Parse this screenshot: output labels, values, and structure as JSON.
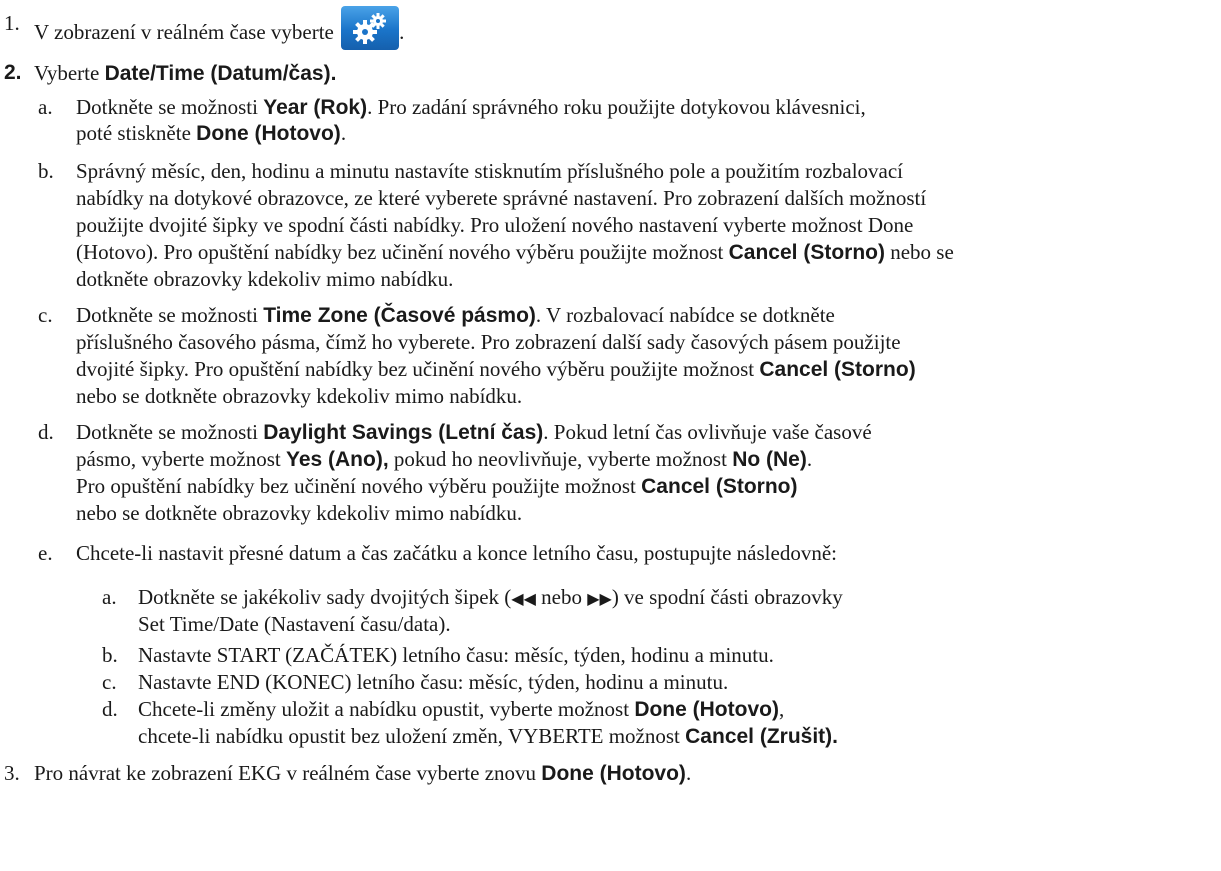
{
  "step1": {
    "num": "1.",
    "text": "V zobrazení v reálném čase vyberte",
    "end": ".",
    "icon": "settings-gears-icon",
    "icon_color": "#1a74c9"
  },
  "step2": {
    "num": "2.",
    "pre": "Vyberte ",
    "bold": "Date/Time (Datum/čas).",
    "a": {
      "num": "a.",
      "l1_pre": "Dotkněte se možnosti ",
      "l1_bold": "Year (Rok)",
      "l1_post": ". Pro zadání správného roku použijte dotykovou klávesnici,",
      "l2_pre": "poté stiskněte ",
      "l2_bold": "Done (Hotovo)",
      "l2_post": "."
    },
    "b": {
      "num": "b.",
      "l1": "Správný měsíc, den, hodinu a minutu nastavíte stisknutím příslušného pole a použitím rozbalovací",
      "l2": "nabídky na dotykové obrazovce, ze které vyberete správné nastavení. Pro zobrazení dalších možností",
      "l3": "použijte dvojité šipky ve spodní části nabídky. Pro uložení nového nastavení vyberte možnost Done",
      "l4_pre": "(Hotovo). Pro opuštění nabídky bez učinění nového výběru použijte možnost ",
      "l4_bold": "Cancel (Storno)",
      "l4_post": " nebo se",
      "l5": "dotkněte obrazovky kdekoliv mimo nabídku."
    },
    "c": {
      "num": "c.",
      "l1_pre": "Dotkněte se možnosti ",
      "l1_bold": "Time Zone (Časové pásmo)",
      "l1_post": ". V rozbalovací nabídce se dotkněte",
      "l2": "příslušného časového pásma, čímž ho vyberete. Pro zobrazení další sady časových pásem použijte",
      "l3_pre": "dvojité šipky. Pro opuštění nabídky bez učinění nového výběru použijte možnost ",
      "l3_bold": "Cancel (Storno)",
      "l4": "nebo se dotkněte obrazovky kdekoliv mimo nabídku."
    },
    "d": {
      "num": "d.",
      "l1_pre": "Dotkněte se možnosti ",
      "l1_bold": "Daylight Savings (Letní čas)",
      "l1_post": ". Pokud letní čas ovlivňuje vaše časové",
      "l2_pre": "pásmo, vyberte možnost ",
      "l2_bold1": "Yes (Ano),",
      "l2_mid": " pokud ho neovlivňuje, vyberte možnost ",
      "l2_bold2": "No (Ne)",
      "l2_post": ".",
      "l3_pre": "Pro opuštění nabídky bez učinění nového výběru použijte možnost ",
      "l3_bold": "Cancel (Storno)",
      "l4": "nebo se dotkněte obrazovky kdekoliv mimo nabídku."
    },
    "e": {
      "num": "e.",
      "text": "Chcete-li nastavit přesné datum a čas začátku a konce letního času, postupujte následovně:",
      "sub": {
        "a": {
          "num": "a.",
          "l1_pre": "Dotkněte se jakékoliv sady dvojitých šipek (",
          "arrow_left": "◀◀",
          "l1_mid": " nebo ",
          "arrow_right": "▶▶",
          "l1_post": ") ve spodní části obrazovky",
          "l2": "Set Time/Date (Nastavení času/data)."
        },
        "b": {
          "num": "b.",
          "text": "Nastavte START (ZAČÁTEK) letního času: měsíc, týden, hodinu a minutu."
        },
        "c": {
          "num": "c.",
          "text": "Nastavte END (KONEC) letního času: měsíc, týden, hodinu a minutu."
        },
        "d": {
          "num": "d.",
          "l1_pre": "Chcete-li změny uložit a nabídku opustit, vyberte možnost ",
          "l1_bold": "Done (Hotovo)",
          "l1_post": ",",
          "l2_pre": "chcete-li nabídku opustit bez uložení změn, VYBERTE možnost ",
          "l2_bold": "Cancel (Zrušit)."
        }
      }
    }
  },
  "step3": {
    "num": "3.",
    "pre": "Pro návrat ke zobrazení EKG v reálném čase vyberte znovu ",
    "bold": "Done (Hotovo)",
    "post": "."
  }
}
